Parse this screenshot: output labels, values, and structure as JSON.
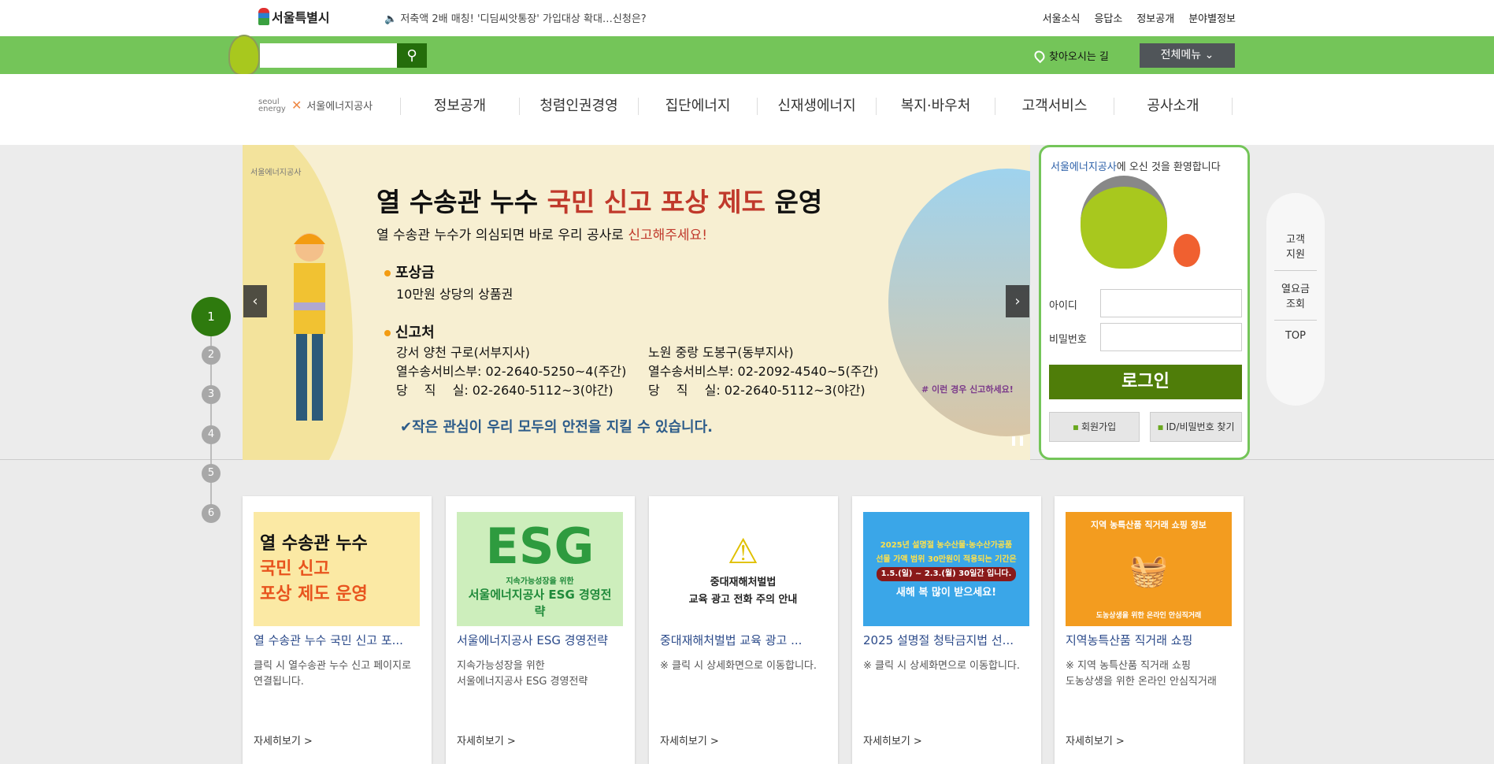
{
  "topbar": {
    "seoul_logo": "서울특별시",
    "notice": "저축액 2배 매칭! '디딤씨앗통장' 가입대상 확대…신청은?",
    "links": [
      "서울소식",
      "응답소",
      "정보공개",
      "분야별정보"
    ]
  },
  "searchbar": {
    "search_value": "",
    "find_way": "찾아오시는 길",
    "all_menu": "전체메뉴"
  },
  "nav": {
    "logo_en": "seoul energy",
    "logo_kr": "서울에너지공사",
    "items": [
      "정보공개",
      "청렴인권경영",
      "집단에너지",
      "신재생에너지",
      "복지·바우처",
      "고객서비스",
      "공사소개"
    ]
  },
  "banner": {
    "logo": "서울에너지공사",
    "title_a": "열 수송관 누수 ",
    "title_b": "국민 신고 포상 제도",
    "title_c": " 운영",
    "sub_a": "열 수송관 누수가 의심되면 바로 우리 공사로 ",
    "sub_b": "신고해주세요!",
    "reward_h": "포상금",
    "reward": "10만원 상당의 상품권",
    "report_h": "신고처",
    "west": "강서 양천 구로(서부지사)",
    "west_day": "열수송서비스부: 02-2640-5250~4(주간)",
    "west_night": "당　 직　 실: 02-2640-5112~3(야간)",
    "east": "노원 중랑 도봉구(동부지사)",
    "east_day": "열수송서비스부: 02-2092-4540~5(주간)",
    "east_night": "당　 직　 실: 02-2640-5112~3(야간)",
    "check": "✔작은 관심이 우리 모두의 안전을 지킬 수 있습니다.",
    "tag": "# 이런 경우 신고하세요!",
    "pager": [
      "1",
      "2",
      "3",
      "4",
      "5",
      "6"
    ]
  },
  "login": {
    "welcome_a": "서울에너지공사",
    "welcome_b": "에 오신 것을 환영합니다",
    "id_label": "아이디",
    "pw_label": "비밀번호",
    "login": "로그인",
    "join": "회원가입",
    "find": "ID/비밀번호 찾기"
  },
  "quick": [
    "고객\n지원",
    "열요금\n조회",
    "TOP"
  ],
  "cards": [
    {
      "thumb": [
        "열 수송관 누수",
        "국민 신고",
        "포상 제도 운영"
      ],
      "title": "열 수송관 누수 국민 신고 포...",
      "desc": "클릭 시 열수송관 누수 신고 페이지로 연결됩니다.",
      "more": "자세히보기 >"
    },
    {
      "thumb": [
        "ESG",
        "지속가능성장을 위한",
        "서울에너지공사 ESG 경영전략"
      ],
      "title": "서울에너지공사 ESG 경영전략",
      "desc": "지속가능성장을 위한\n서울에너지공사 ESG 경영전략",
      "more": "자세히보기 >"
    },
    {
      "thumb": [
        "⚠",
        "중대재해처벌법",
        "교육 광고 전화 주의 안내"
      ],
      "title": "중대재해처벌법 교육 광고 ...",
      "desc": "※ 클릭 시 상세화면으로 이동합니다.",
      "more": "자세히보기 >"
    },
    {
      "thumb": [
        "2025년 설명절 농수산물·농수산가공품",
        "선물 가액 범위 30만원이 적용되는 기간은",
        "1.5.(일) ~ 2.3.(월) 30일간 입니다.",
        "새해 복 많이 받으세요!"
      ],
      "title": "2025 설명절 청탁금지법 선...",
      "desc": "※ 클릭 시 상세화면으로 이동합니다.",
      "more": "자세히보기 >"
    },
    {
      "thumb": [
        "지역 농특산품 직거래 쇼핑 정보",
        "도농상생을 위한 온라인 안심직거래"
      ],
      "title": "지역농특산품 직거래 쇼핑",
      "desc": "※ 지역 농특산품 직거래 쇼핑\n도농상생을 위한 온라인 안심직거래",
      "more": "자세히보기 >"
    }
  ]
}
